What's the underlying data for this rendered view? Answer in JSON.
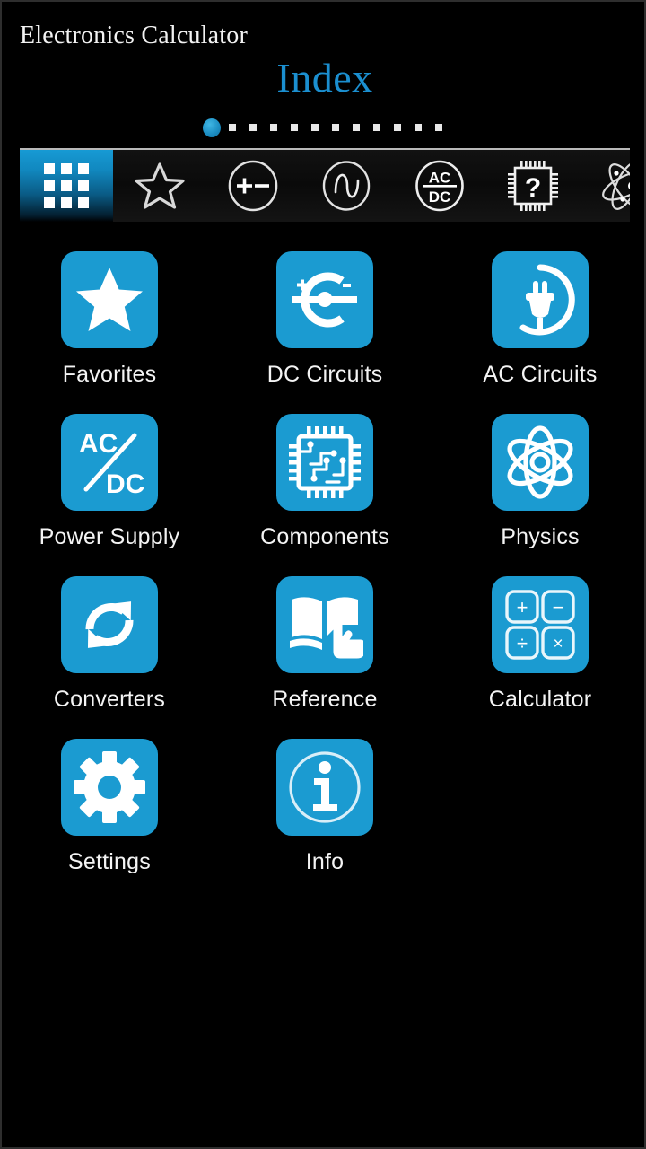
{
  "app": {
    "title": "Electronics Calculator",
    "page_title": "Index"
  },
  "colors": {
    "accent": "#1b9bd1",
    "title_blue": "#1b8fd0",
    "background": "#000000",
    "tile_icon": "#ffffff"
  },
  "pager": {
    "total_pages": 12,
    "active_index": 0
  },
  "tabs": [
    {
      "name": "grid-icon",
      "label": "Index",
      "active": true
    },
    {
      "name": "star-icon",
      "label": "Favorites",
      "active": false
    },
    {
      "name": "dc-circle-icon",
      "label": "DC Circuits",
      "active": false
    },
    {
      "name": "waveform-icon",
      "label": "AC Circuits",
      "active": false
    },
    {
      "name": "acdc-icon",
      "label": "Power Supply",
      "active": false
    },
    {
      "name": "chip-question-icon",
      "label": "Components",
      "active": false
    },
    {
      "name": "atom-icon",
      "label": "Physics",
      "active": false
    }
  ],
  "apps": [
    {
      "label": "Favorites",
      "icon": "star-icon"
    },
    {
      "label": "DC Circuits",
      "icon": "dc-terminal-icon"
    },
    {
      "label": "AC Circuits",
      "icon": "plug-circle-icon"
    },
    {
      "label": "Power Supply",
      "icon": "ac-dc-icon",
      "icon_text_top": "AC",
      "icon_text_bottom": "DC"
    },
    {
      "label": "Components",
      "icon": "chip-icon"
    },
    {
      "label": "Physics",
      "icon": "atom-icon"
    },
    {
      "label": "Converters",
      "icon": "refresh-arrows-icon"
    },
    {
      "label": "Reference",
      "icon": "book-hand-icon"
    },
    {
      "label": "Calculator",
      "icon": "calculator-keys-icon",
      "keys": [
        "+",
        "−",
        "÷",
        "×"
      ]
    },
    {
      "label": "Settings",
      "icon": "gear-icon"
    },
    {
      "label": "Info",
      "icon": "info-circle-icon"
    }
  ]
}
